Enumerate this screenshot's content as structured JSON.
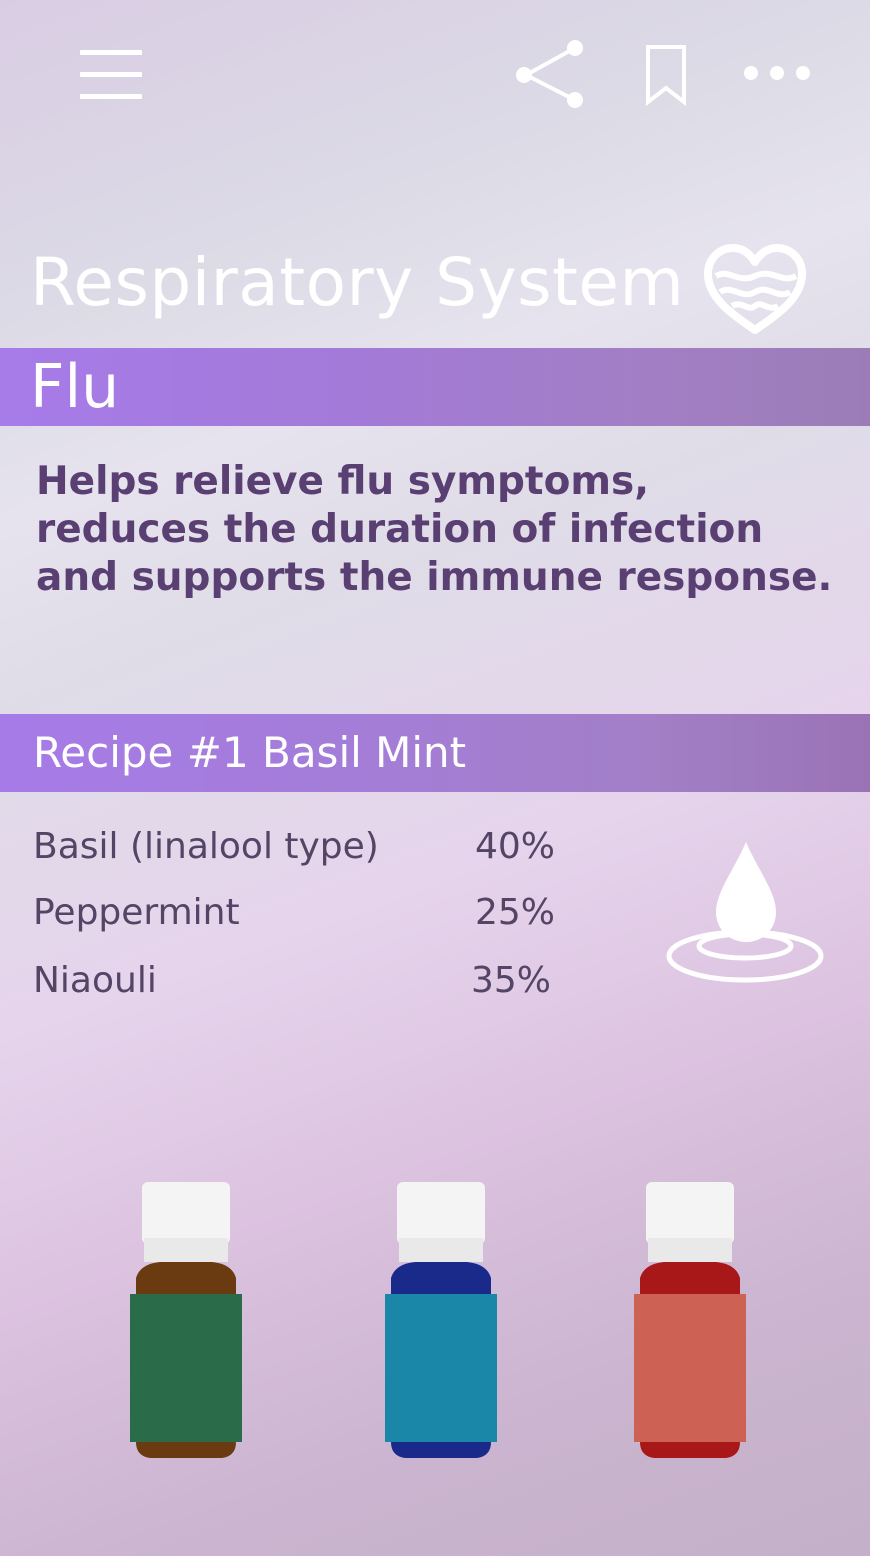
{
  "header": {
    "menu_icon": "hamburger-menu-icon",
    "share_icon": "share-icon",
    "bookmark_icon": "bookmark-icon",
    "more_icon": "more-horizontal-icon"
  },
  "page": {
    "title": "Respiratory System",
    "section_icon": "heart-waves-icon"
  },
  "condition": {
    "name": "Flu",
    "description": "Helps relieve flu symptoms, reduces the duration of infection and supports the immune response."
  },
  "recipe": {
    "title": "Recipe #1 Basil Mint",
    "icon": "water-drop-icon",
    "ingredients": [
      {
        "name": "Basil (linalool type)",
        "percent": "40%"
      },
      {
        "name": "Peppermint",
        "percent": "25%"
      },
      {
        "name": "Niaouli",
        "percent": "35%"
      }
    ]
  },
  "bottles": [
    {
      "label_color": "#2a6b4a",
      "glass_color": "#6a3a10"
    },
    {
      "label_color": "#1a86a8",
      "glass_color": "#1a2a8a"
    },
    {
      "label_color": "#cd6153",
      "glass_color": "#a81818"
    }
  ]
}
